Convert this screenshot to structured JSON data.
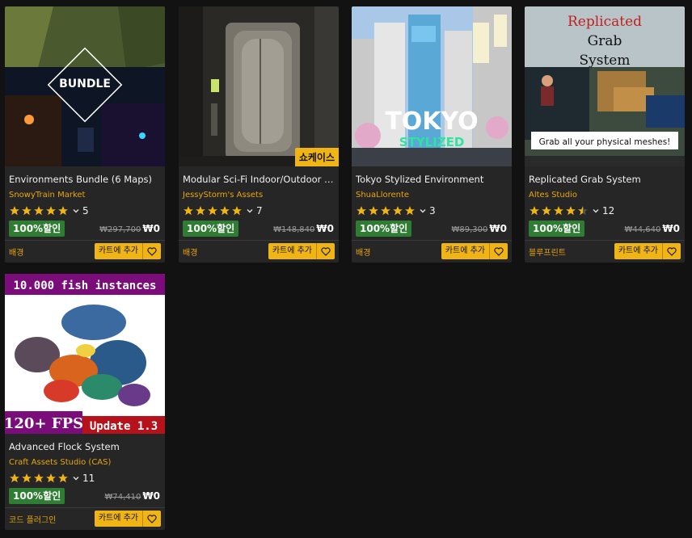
{
  "products": [
    {
      "title": "Environments Bundle (6 Maps)",
      "seller": "SnowyTrain Market",
      "rating": 5,
      "rating_count": "5",
      "discount": "100%할인",
      "old_price": "₩297,700",
      "new_price": "₩0",
      "category": "배경",
      "cart_label": "카트에 추가",
      "thumb_text": "BUNDLE"
    },
    {
      "title": "Modular Sci-Fi Indoor/Outdoor e...",
      "seller": "JessyStorm's Assets",
      "rating": 5,
      "rating_count": "7",
      "discount": "100%할인",
      "old_price": "₩148,840",
      "new_price": "₩0",
      "category": "배경",
      "cart_label": "카트에 추가",
      "badge": "쇼케이스"
    },
    {
      "title": "Tokyo Stylized Environment",
      "seller": "ShuaLlorente",
      "rating": 5,
      "rating_count": "3",
      "discount": "100%할인",
      "old_price": "₩89,300",
      "new_price": "₩0",
      "category": "배경",
      "cart_label": "카트에 추가",
      "thumb_text": "TOKYO",
      "thumb_subtext": "STYLIZED"
    },
    {
      "title": "Replicated Grab System",
      "seller": "Altes Studio",
      "rating": 4.5,
      "rating_count": "12",
      "discount": "100%할인",
      "old_price": "₩44,640",
      "new_price": "₩0",
      "category": "블루프린트",
      "cart_label": "카트에 추가",
      "thumb_lines": [
        "Replicated",
        "Grab",
        "System"
      ],
      "thumb_caption": "Grab all your physical meshes!"
    },
    {
      "title": "Advanced Flock System",
      "seller": "Craft Assets Studio (CAS)",
      "rating": 5,
      "rating_count": "11",
      "discount": "100%할인",
      "old_price": "₩74,410",
      "new_price": "₩0",
      "category": "코드 플러그인",
      "cart_label": "카트에 추가",
      "thumb_top": "10.000 fish instances",
      "thumb_fps": "120+ FPS",
      "thumb_update": "Update 1.3"
    }
  ],
  "colors": {
    "accent": "#f0b514",
    "seller": "#e9a60c",
    "discount_bg": "#2e7d32",
    "card_bg": "#262626",
    "page_bg": "#121212"
  }
}
